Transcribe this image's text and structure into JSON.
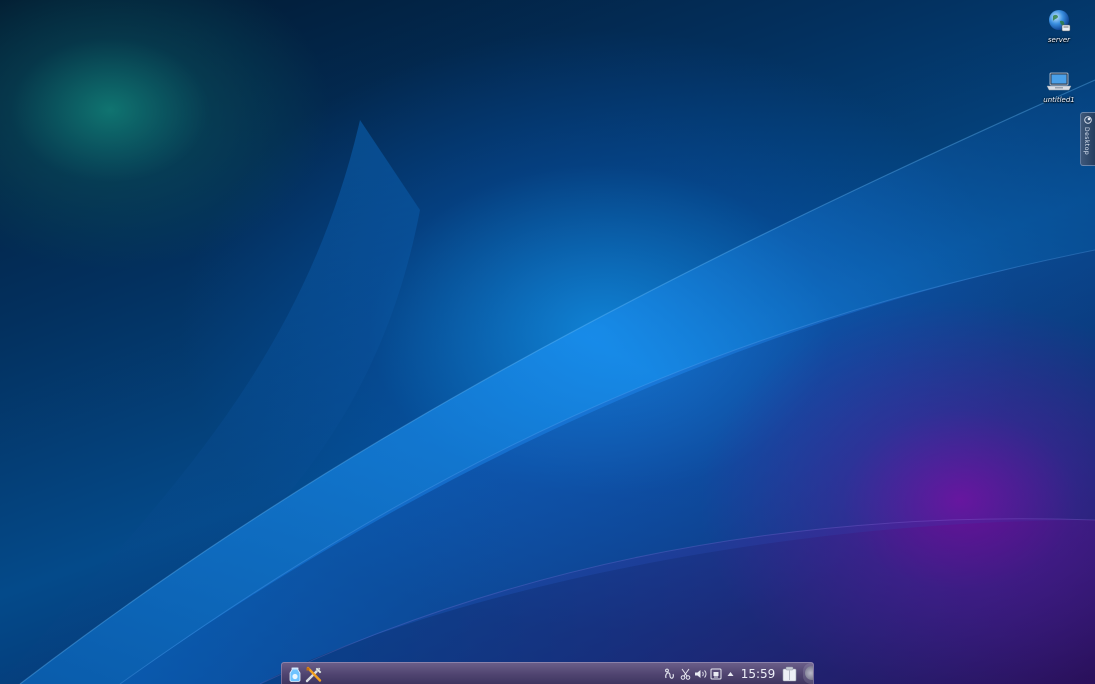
{
  "desktop_icons": [
    {
      "label": "server",
      "icon": "globe-server-icon"
    },
    {
      "label": "untitled1",
      "icon": "laptop-icon"
    }
  ],
  "desktop_toolbox": {
    "label": "Desktop"
  },
  "panel": {
    "launcher_icon": "application-launcher-icon",
    "settings_icon": "system-settings-icon",
    "systray": [
      "activities-icon",
      "klipper-scissors-icon",
      "volume-icon",
      "network-icon",
      "expand-arrow-icon"
    ],
    "clock": "15:59",
    "show_desktop_icon": "show-desktop-icon"
  },
  "colors": {
    "panel": "#4f4470",
    "wallpaper_teal": "#12827a",
    "wallpaper_blue": "#1496f0",
    "wallpaper_purple": "#8c00a0"
  }
}
